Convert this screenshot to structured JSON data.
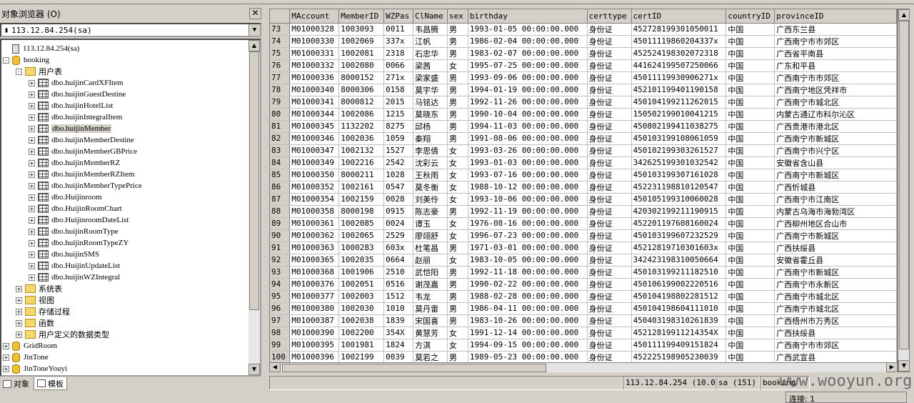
{
  "object_browser": {
    "title": "对象浏览器 (O)",
    "close_glyph": "✕",
    "server_select": "113.12.84.254(sa)",
    "tree": [
      {
        "level": 0,
        "kind": "server",
        "toggle": "",
        "label": "113.12.84.254(sa)",
        "selected": false
      },
      {
        "level": 0,
        "kind": "db",
        "toggle": "-",
        "label": "booking",
        "selected": false
      },
      {
        "level": 1,
        "kind": "folder",
        "toggle": "-",
        "label": "用户表",
        "selected": false
      },
      {
        "level": 2,
        "kind": "table",
        "toggle": "+",
        "label": "dbo.huijinCardXFItem",
        "selected": false
      },
      {
        "level": 2,
        "kind": "table",
        "toggle": "+",
        "label": "dbo.huijinGuestDestine",
        "selected": false
      },
      {
        "level": 2,
        "kind": "table",
        "toggle": "+",
        "label": "dbo.huijinHotelList",
        "selected": false
      },
      {
        "level": 2,
        "kind": "table",
        "toggle": "+",
        "label": "dbo.huijinIntegralItem",
        "selected": false
      },
      {
        "level": 2,
        "kind": "table",
        "toggle": "+",
        "label": "dbo.huijinMember",
        "selected": true
      },
      {
        "level": 2,
        "kind": "table",
        "toggle": "+",
        "label": "dbo.huijinMemberDestine",
        "selected": false
      },
      {
        "level": 2,
        "kind": "table",
        "toggle": "+",
        "label": "dbo.huijinMemberGBPrice",
        "selected": false
      },
      {
        "level": 2,
        "kind": "table",
        "toggle": "+",
        "label": "dbo.huijinMemberRZ",
        "selected": false
      },
      {
        "level": 2,
        "kind": "table",
        "toggle": "+",
        "label": "dbo.huijinMemberRZItem",
        "selected": false
      },
      {
        "level": 2,
        "kind": "table",
        "toggle": "+",
        "label": "dbo.huijinMemberTypePrice",
        "selected": false
      },
      {
        "level": 2,
        "kind": "table",
        "toggle": "+",
        "label": "dbo.Huijinroom",
        "selected": false
      },
      {
        "level": 2,
        "kind": "table",
        "toggle": "+",
        "label": "dbo.HuijinRoomChart",
        "selected": false
      },
      {
        "level": 2,
        "kind": "table",
        "toggle": "+",
        "label": "dbo.HuijinroomDateList",
        "selected": false
      },
      {
        "level": 2,
        "kind": "table",
        "toggle": "+",
        "label": "dbo.huijinRoomType",
        "selected": false
      },
      {
        "level": 2,
        "kind": "table",
        "toggle": "+",
        "label": "dbo.huijinRoomTypeZY",
        "selected": false
      },
      {
        "level": 2,
        "kind": "table",
        "toggle": "+",
        "label": "dbo.huijinSMS",
        "selected": false
      },
      {
        "level": 2,
        "kind": "table",
        "toggle": "+",
        "label": "dbo.HuijinUpdateList",
        "selected": false
      },
      {
        "level": 2,
        "kind": "table",
        "toggle": "+",
        "label": "dbo.huijinWZIntegral",
        "selected": false
      },
      {
        "level": 1,
        "kind": "folder",
        "toggle": "+",
        "label": "系统表",
        "selected": false
      },
      {
        "level": 1,
        "kind": "folder",
        "toggle": "+",
        "label": "视图",
        "selected": false
      },
      {
        "level": 1,
        "kind": "folder",
        "toggle": "+",
        "label": "存储过程",
        "selected": false
      },
      {
        "level": 1,
        "kind": "folder",
        "toggle": "+",
        "label": "函数",
        "selected": false
      },
      {
        "level": 1,
        "kind": "folder",
        "toggle": "+",
        "label": "用户定义的数据类型",
        "selected": false
      },
      {
        "level": 0,
        "kind": "db",
        "toggle": "+",
        "label": "GridRoom",
        "selected": false
      },
      {
        "level": 0,
        "kind": "db",
        "toggle": "+",
        "label": "JinTone",
        "selected": false
      },
      {
        "level": 0,
        "kind": "db",
        "toggle": "+",
        "label": "JinToneYouyi",
        "selected": false
      }
    ],
    "tabs": [
      {
        "label": "对象",
        "active": false
      },
      {
        "label": "模板",
        "active": true
      }
    ]
  },
  "results_grid": {
    "columns": [
      "MAccount",
      "MemberID",
      "WZPas",
      "ClName",
      "sex",
      "birthday",
      "certtype",
      "certID",
      "countryID",
      "provinceID"
    ],
    "rows": [
      [
        "73",
        "M01000328",
        "1003093",
        "0011",
        "韦昌腾",
        "男",
        "1993-01-05 00:00:00.000",
        "身份证",
        "452728199301050011",
        "中国",
        "广西东兰县"
      ],
      [
        "74",
        "M01000330",
        "1002069",
        "337x",
        "江帆",
        "男",
        "1986-02-04 00:00:00.000",
        "身份证",
        "45011119860204337x",
        "中国",
        "广西南宁市市郊区"
      ],
      [
        "75",
        "M01000331",
        "1002081",
        "2318",
        "石忠华",
        "男",
        "1983-02-07 00:00:00.000",
        "身份证",
        "452524198302072318",
        "中国",
        "广西省平南县"
      ],
      [
        "76",
        "M01000332",
        "1002080",
        "0066",
        "梁茜",
        "女",
        "1995-07-25 00:00:00.000",
        "身份证",
        "441624199507250066",
        "中国",
        "广东和平县"
      ],
      [
        "77",
        "M01000336",
        "8000152",
        "271x",
        "梁家盛",
        "男",
        "1993-09-06 00:00:00.000",
        "身份证",
        "45011119930906271x",
        "中国",
        "广西南宁市市郊区"
      ],
      [
        "78",
        "M01000340",
        "8000306",
        "0158",
        "莫宇华",
        "男",
        "1994-01-19 00:00:00.000",
        "身份证",
        "452101199401190158",
        "中国",
        "广西南宁地区凭祥市"
      ],
      [
        "79",
        "M01000341",
        "8000812",
        "2015",
        "马铭达",
        "男",
        "1992-11-26 00:00:00.000",
        "身份证",
        "450104199211262015",
        "中国",
        "广西南宁市城北区"
      ],
      [
        "80",
        "M01000344",
        "1002086",
        "1215",
        "莫晓东",
        "男",
        "1990-10-04 00:00:00.000",
        "身份证",
        "150502199010041215",
        "中国",
        "内蒙古通辽市科尔沁区"
      ],
      [
        "81",
        "M01000345",
        "1132202",
        "8275",
        "邱杨",
        "男",
        "1994-11-03 00:00:00.000",
        "身份证",
        "450802199411038275",
        "中国",
        "广西贵港市港北区"
      ],
      [
        "82",
        "M01000346",
        "1002036",
        "1059",
        "秦翔",
        "男",
        "1991-08-06 00:00:00.000",
        "身份证",
        "450103199108061059",
        "中国",
        "广西南宁市新城区"
      ],
      [
        "83",
        "M01000347",
        "1002132",
        "1527",
        "李思倩",
        "女",
        "1993-03-26 00:00:00.000",
        "身份证",
        "450102199303261527",
        "中国",
        "广西南宁市兴宁区"
      ],
      [
        "84",
        "M01000349",
        "1002216",
        "2542",
        "沈彩云",
        "女",
        "1993-01-03 00:00:00.000",
        "身份证",
        "342625199301032542",
        "中国",
        "安徽省含山县"
      ],
      [
        "85",
        "M01000350",
        "8000211",
        "1028",
        "王秋雨",
        "女",
        "1993-07-16 00:00:00.000",
        "身份证",
        "450103199307161028",
        "中国",
        "广西南宁市新城区"
      ],
      [
        "86",
        "M01000352",
        "1002161",
        "0547",
        "莫冬衡",
        "女",
        "1988-10-12 00:00:00.000",
        "身份证",
        "452231198810120547",
        "中国",
        "广西忻城县"
      ],
      [
        "87",
        "M01000354",
        "1002159",
        "0028",
        "刘美伶",
        "女",
        "1993-10-06 00:00:00.000",
        "身份证",
        "450105199310060028",
        "中国",
        "广西南宁市江南区"
      ],
      [
        "88",
        "M01000358",
        "8000198",
        "0915",
        "陈志豪",
        "男",
        "1992-11-19 00:00:00.000",
        "身份证",
        "420302199211190915",
        "中国",
        "内蒙古乌海市海勃湾区"
      ],
      [
        "89",
        "M01000361",
        "1002085",
        "0024",
        "谭玉",
        "女",
        "1976-08-16 00:00:00.000",
        "身份证",
        "452201197608160024",
        "中国",
        "广西柳州地区合山市"
      ],
      [
        "90",
        "M01000362",
        "1002065",
        "2529",
        "廖翊舒",
        "女",
        "1996-07-23 00:00:00.000",
        "身份证",
        "450103199607232529",
        "中国",
        "广西南宁市新城区"
      ],
      [
        "91",
        "M01000363",
        "1000283",
        "603x",
        "杜笔昌",
        "男",
        "1971-03-01 00:00:00.000",
        "身份证",
        "45212819710301603x",
        "中国",
        "广西扶绥县"
      ],
      [
        "92",
        "M01000365",
        "1002035",
        "0664",
        "赵丽",
        "女",
        "1983-10-05 00:00:00.000",
        "身份证",
        "342423198310050664",
        "中国",
        "安徽省霍丘县"
      ],
      [
        "93",
        "M01000368",
        "1001906",
        "2510",
        "武恺阳",
        "男",
        "1992-11-18 00:00:00.000",
        "身份证",
        "450103199211182510",
        "中国",
        "广西南宁市新城区"
      ],
      [
        "94",
        "M01000376",
        "1002051",
        "0516",
        "谢茂嘉",
        "男",
        "1990-02-22 00:00:00.000",
        "身份证",
        "450106199002220516",
        "中国",
        "广西南宁市永新区"
      ],
      [
        "95",
        "M01000377",
        "1002003",
        "1512",
        "韦龙",
        "男",
        "1988-02-28 00:00:00.000",
        "身份证",
        "450104198802281512",
        "中国",
        "广西南宁市城北区"
      ],
      [
        "96",
        "M01000380",
        "1002030",
        "1010",
        "莫丹雷",
        "男",
        "1986-04-11 00:00:00.000",
        "身份证",
        "450104198604111010",
        "中国",
        "广西南宁市城北区"
      ],
      [
        "97",
        "M01000387",
        "1002038",
        "1839",
        "宋国喜",
        "男",
        "1983-10-26 00:00:00.000",
        "身份证",
        "450403198310261839",
        "中国",
        "广西梧州市万秀区"
      ],
      [
        "98",
        "M01000390",
        "1002200",
        "354X",
        "黄慧芳",
        "女",
        "1991-12-14 00:00:00.000",
        "身份证",
        "45212819911214354X",
        "中国",
        "广西扶绥县"
      ],
      [
        "99",
        "M01000395",
        "1001981",
        "1824",
        "方淇",
        "女",
        "1994-09-15 00:00:00.000",
        "身份证",
        "450111199409151824",
        "中国",
        "广西南宁市市郊区"
      ],
      [
        "100",
        "M01000396",
        "1002199",
        "0039",
        "莫若之",
        "男",
        "1989-05-23 00:00:00.000",
        "身份证",
        "452225198905230039",
        "中国",
        "广西武宣县"
      ]
    ]
  },
  "status_bar": {
    "server": "113.12.84.254 (10.0)",
    "user": "sa (151)",
    "database": "booking",
    "connections": "连接: 1"
  },
  "watermark": "www.wooyun.org",
  "colors": {
    "chrome": "#d4d0c8",
    "grid_bg": "#ffffff",
    "selection": "#d4d0c8"
  }
}
